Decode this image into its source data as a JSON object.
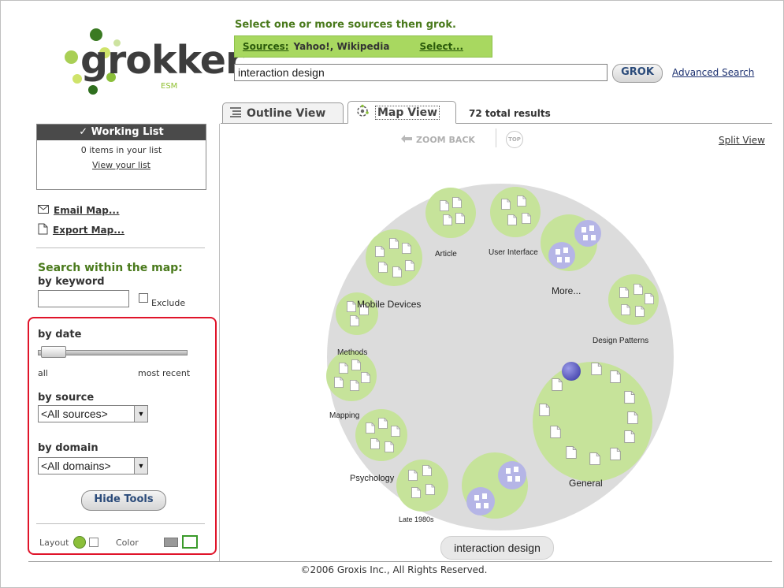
{
  "logo": {
    "word": "grokker",
    "sub": "ESM"
  },
  "header": {
    "instruction": "Select one or more sources then grok.",
    "sources_label": "Sources:",
    "sources_value": "Yahoo!, Wikipedia",
    "select_link": "Select...",
    "search_value": "interaction design",
    "grok_button": "GROK",
    "advanced_search": "Advanced Search"
  },
  "tabs": {
    "outline": "Outline View",
    "map": "Map View",
    "total_results": "72 total results"
  },
  "working_list": {
    "title": "Working List",
    "count": "0 items in your list",
    "view_link": "View your list"
  },
  "actions": {
    "email": "Email Map...",
    "export": "Export Map..."
  },
  "search_map": {
    "title": "Search within the map:",
    "by_keyword": "by keyword",
    "keyword_value": "",
    "exclude": "Exclude",
    "by_date": "by date",
    "date_min": "all",
    "date_max": "most recent",
    "by_source": "by source",
    "source_selected": "<All sources>",
    "by_domain": "by domain",
    "domain_selected": "<All domains>",
    "hide_tools": "Hide Tools",
    "layout_label": "Layout",
    "color_label": "Color"
  },
  "map_toolbar": {
    "zoom_back": "ZOOM BACK",
    "top": "TOP",
    "split_view": "Split View"
  },
  "map": {
    "labels": {
      "article": "Article",
      "user_interface": "User Interface",
      "more": "More...",
      "mobile_devices": "Mobile Devices",
      "design_patterns": "Design Patterns",
      "methods": "Methods",
      "mapping": "Mapping",
      "general": "General",
      "psychology": "Psychology",
      "late_1980s": "Late 1980s"
    },
    "query": "interaction design",
    "colors": {
      "outer": "#dcdcdc",
      "cluster": "#c6e39a",
      "subcluster": "#b5b5e6",
      "document": "#ffffff"
    }
  },
  "footer": {
    "copyright": "©2006 Groxis Inc., All Rights Reserved."
  }
}
